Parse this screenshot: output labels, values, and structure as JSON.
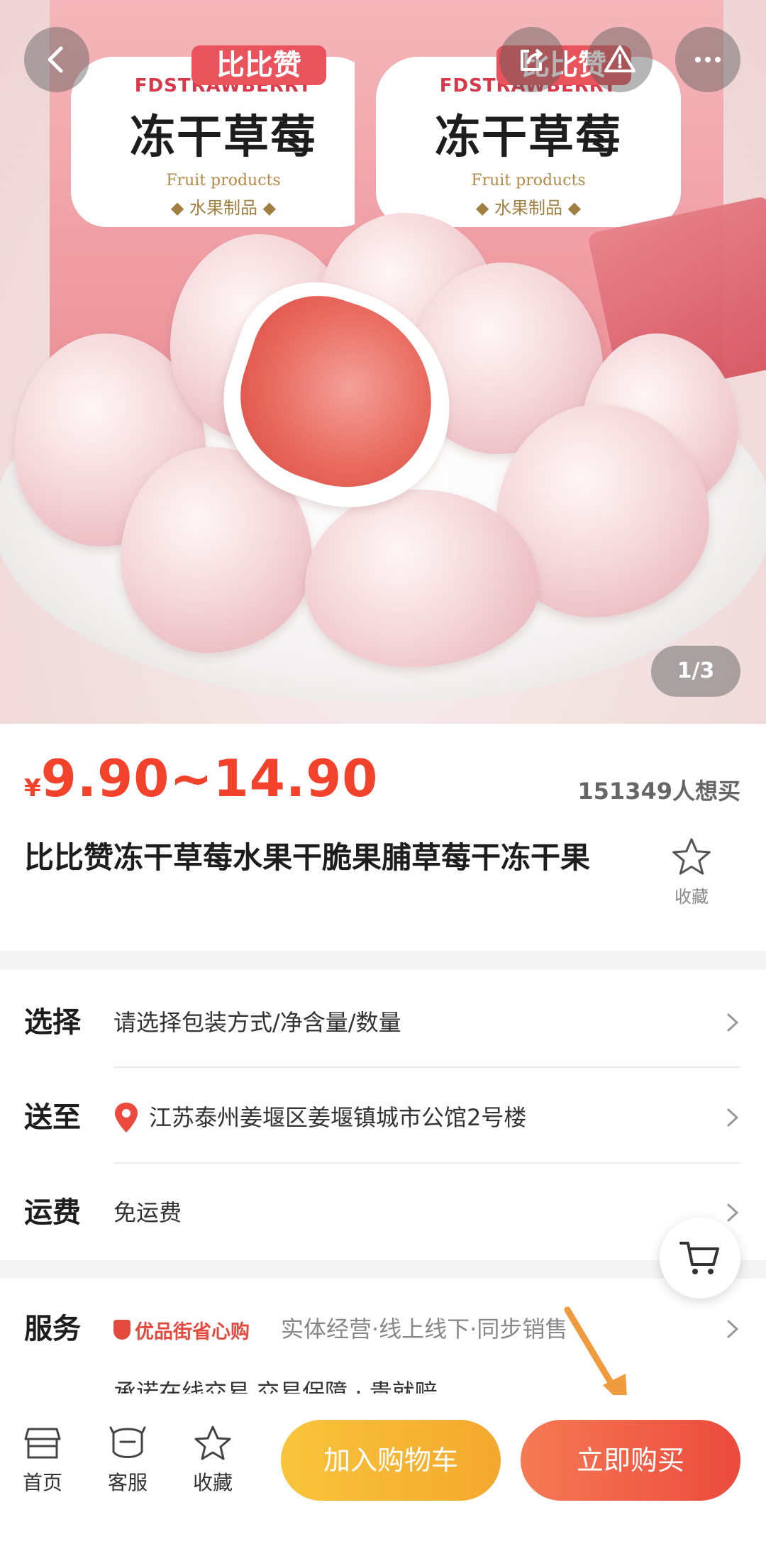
{
  "gallery": {
    "pack_brand": "比比赞",
    "pack_en": "FDSTRAWBERRY",
    "pack_cn": "冻干草莓",
    "pack_fruit": "Fruit products",
    "pack_tag": "◆ 水果制品 ◆",
    "counter": "1/3",
    "icons": [
      "back-icon",
      "share-icon",
      "report-icon",
      "more-icon"
    ]
  },
  "product": {
    "currency": "¥",
    "price": "9.90~14.90",
    "want_count": "151349人想买",
    "title": "比比赞冻干草莓水果干脆果脯草莓干冻干果",
    "fav_label": "收藏"
  },
  "options": {
    "select_key": "选择",
    "select_value": "请选择包装方式/净含量/数量",
    "ship_to_key": "送至",
    "ship_to_value": "江苏泰州姜堰区姜堰镇城市公馆2号楼",
    "freight_key": "运费",
    "freight_value": "免运费",
    "service_key": "服务",
    "service_badge": "优品街省心购",
    "service_desc": "实体经营·线上线下·同步销售",
    "service_more": "承诺在线交易 交易保障 · 贵就赔"
  },
  "bottom_bar": {
    "home": "首页",
    "service": "客服",
    "favorite": "收藏",
    "add_to_cart": "加入购物车",
    "buy_now": "立即购买"
  },
  "colors": {
    "price_red": "#f3422c",
    "cart_button": "#f6b534",
    "buy_button": "#ef5c45",
    "annotation_arrow": "#ef9a3c"
  }
}
